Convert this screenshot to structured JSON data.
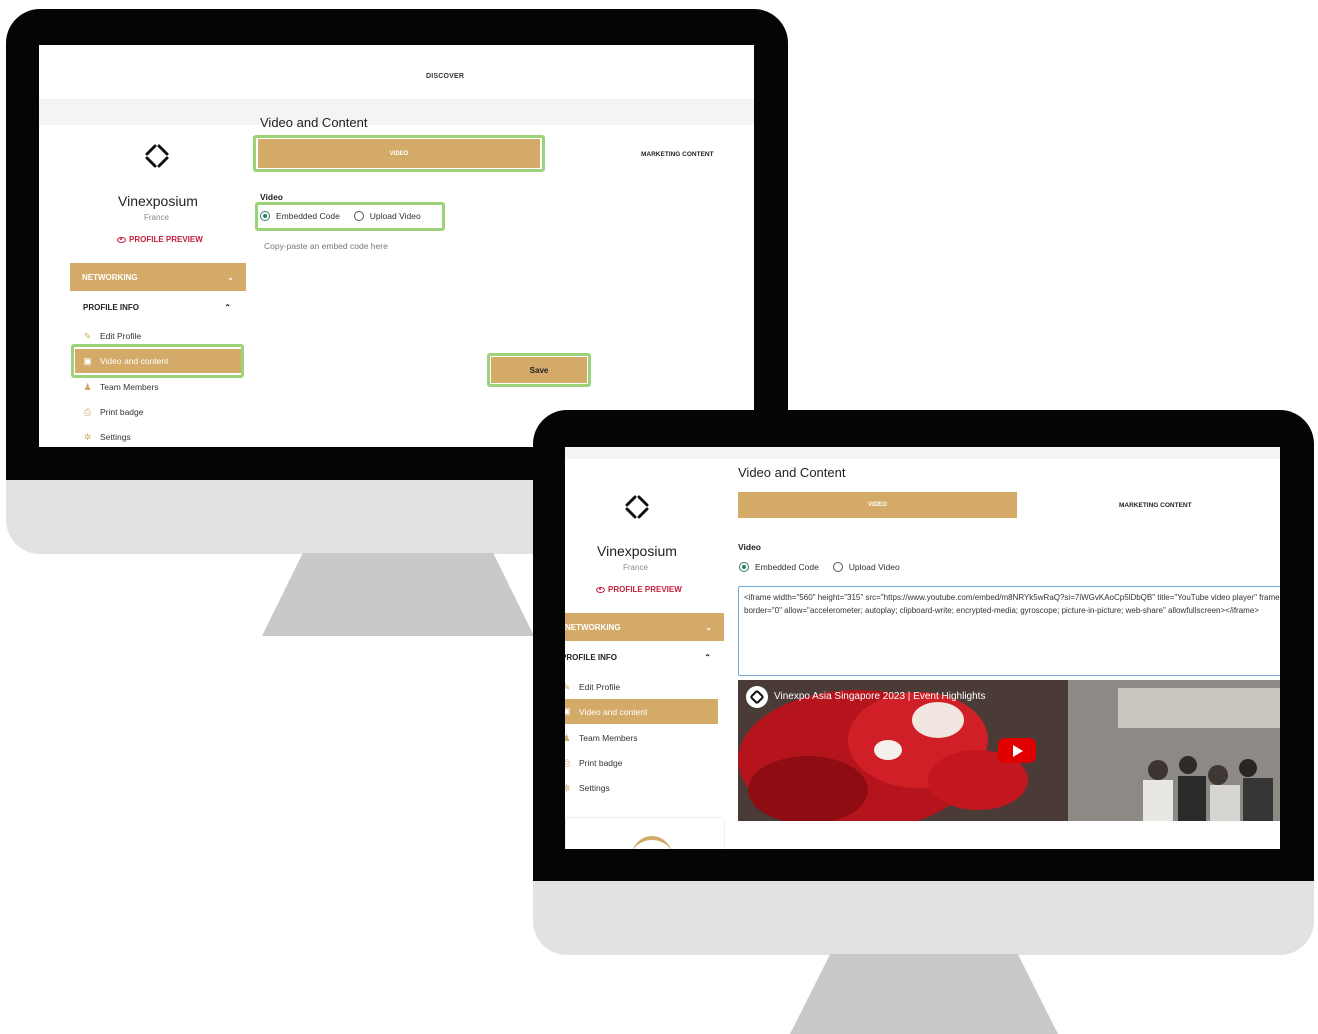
{
  "screen1": {
    "topbar": {
      "discover_label": "DISCOVER"
    },
    "sidebar": {
      "org_name": "Vinexposium",
      "org_country": "France",
      "profile_preview_label": "PROFILE PREVIEW",
      "networking_label": "NETWORKING",
      "profile_info_label": "PROFILE INFO",
      "items": [
        {
          "label": "Edit Profile",
          "icon": "pencil-icon"
        },
        {
          "label": "Video and content",
          "icon": "video-icon"
        },
        {
          "label": "Team Members",
          "icon": "team-icon"
        },
        {
          "label": "Print badge",
          "icon": "printer-icon"
        },
        {
          "label": "Settings",
          "icon": "gear-icon"
        }
      ]
    },
    "main": {
      "title": "Video and Content",
      "tab_video": "VIDEO",
      "tab_marketing": "MARKETING CONTENT",
      "video_label": "Video",
      "option_embedded": "Embedded Code",
      "option_upload": "Upload Video",
      "hint": "Copy-paste an embed code here",
      "save_label": "Save"
    }
  },
  "screen2": {
    "sidebar": {
      "org_name": "Vinexposium",
      "org_country": "France",
      "profile_preview_label": "PROFILE PREVIEW",
      "networking_label": "NETWORKING",
      "profile_info_label": "PROFILE INFO",
      "items": [
        {
          "label": "Edit Profile",
          "icon": "pencil-icon"
        },
        {
          "label": "Video and content",
          "icon": "video-icon"
        },
        {
          "label": "Team Members",
          "icon": "team-icon"
        },
        {
          "label": "Print badge",
          "icon": "printer-icon"
        },
        {
          "label": "Settings",
          "icon": "gear-icon"
        }
      ]
    },
    "main": {
      "title": "Video and Content",
      "tab_video": "VIDEO",
      "tab_marketing": "MARKETING CONTENT",
      "video_label": "Video",
      "option_embedded": "Embedded Code",
      "option_upload": "Upload Video",
      "embed_code": "<iframe width=\"560\" height=\"315\" src=\"https://www.youtube.com/embed/m8NRYk5wRaQ?si=7iWGvKAoCp5lDbQB\" title=\"YouTube video player\" frameborder=\"0\" allow=\"accelerometer; autoplay; clipboard-write; encrypted-media; gyroscope; picture-in-picture; web-share\" allowfullscreen></iframe>",
      "video_title": "Vinexpo Asia Singapore 2023 | Event Highlights"
    }
  },
  "colors": {
    "accent_gold": "#d4aa68",
    "highlight_green": "#9bd27a",
    "preview_red": "#c41f3a",
    "radio_green": "#2f7d5a"
  }
}
